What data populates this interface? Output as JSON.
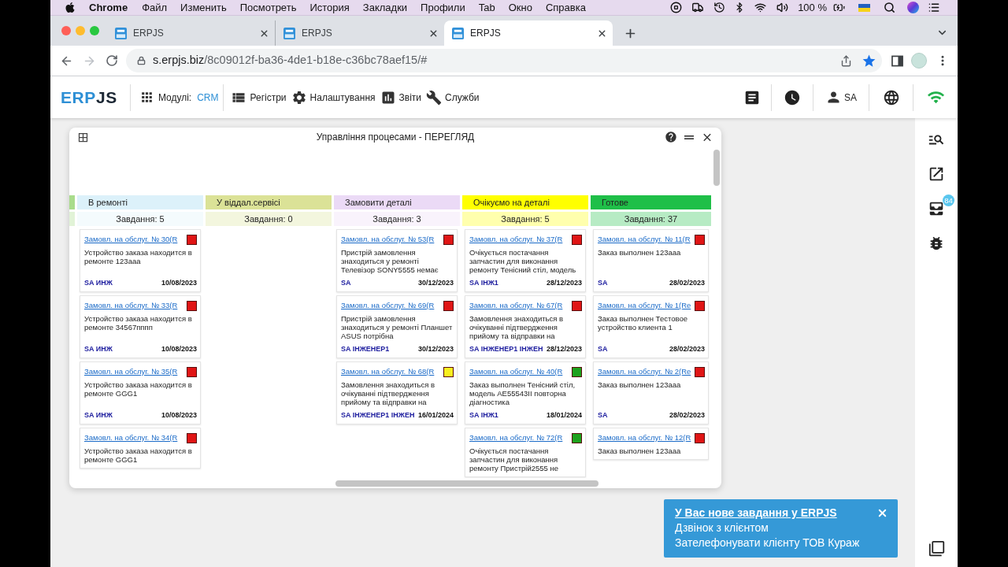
{
  "menubar": {
    "app": "Chrome",
    "menus": [
      "Файл",
      "Изменить",
      "Посмотреть",
      "История",
      "Закладки",
      "Профили",
      "Tab",
      "Окно",
      "Справка"
    ],
    "battery": "100 %"
  },
  "browser": {
    "tabs": [
      {
        "title": "ERPJS",
        "selected": false
      },
      {
        "title": "ERPJS",
        "selected": false
      },
      {
        "title": "ERPJS",
        "selected": true
      }
    ],
    "back_disabled": false,
    "forward_disabled": true,
    "url_host": "s.erpjs.biz",
    "url_path": "/8c09012f-ba36-4de1-b18e-c36bc78aef15/#",
    "bookmarked": true
  },
  "header": {
    "logo": [
      "ERP",
      "JS"
    ],
    "modules_label": "Модулі:",
    "module": "CRM",
    "nav": [
      "Регістри",
      "Налаштування",
      "Звіти",
      "Служби"
    ],
    "user": "SA"
  },
  "window": {
    "title": "Управління процесами - ПЕРЕГЛЯД",
    "columns": [
      {
        "color": "#a9dc8c"
      },
      {
        "title": "В ремонті",
        "color": "#dcf1fa",
        "count": "Завдання: 5",
        "cards": [
          {
            "title": "Замовл. на обслуг. № 30(R",
            "color": "#e01515",
            "description": "Устройство заказа находится в ремонте 123aaa",
            "assignee": "SA ИНЖ",
            "date": "10/08/2023"
          },
          {
            "title": "Замовл. на обслуг. № 33(R",
            "color": "#e01515",
            "description": "Устройство заказа находится в ремонте 34567пппп",
            "assignee": "SA ИНЖ",
            "date": "10/08/2023"
          },
          {
            "title": "Замовл. на обслуг. № 35(R",
            "color": "#e01515",
            "description": "Устройство заказа находится в ремонте GGG1",
            "assignee": "SA ИНЖ",
            "date": "10/08/2023"
          },
          {
            "title": "Замовл. на обслуг. № 34(R",
            "color": "#e01515",
            "description": "Устройство заказа находится в ремонте GGG1"
          }
        ]
      },
      {
        "title": "У віддал.сервісі",
        "color": "#dbe297",
        "count": "Завдання: 0"
      },
      {
        "title": "Замовити деталі",
        "color": "#ebdaf6",
        "count": "Завдання: 3",
        "cards": [
          {
            "title": "Замовл. на обслуг. № 53(R",
            "color": "#e01515",
            "description": "Пристрій замовлення знаходиться у ремонті Телевізор SONY5555 немає",
            "assignee": "SA",
            "date": "30/12/2023"
          },
          {
            "title": "Замовл. на обслуг. № 69(R",
            "color": "#e01515",
            "description": "Пристрій замовлення знаходиться у ремонті Планшет ASUS потрібна",
            "assignee": "SA ІНЖЕНЕР1",
            "date": "30/12/2023"
          },
          {
            "title": "Замовл. на обслуг. № 68(R",
            "color": "#f7ef1f",
            "description": "Замовлення знаходиться в очікуванні підтвердження прийому та відправки на",
            "assignee": "SA ІНЖЕНЕР1 ІНЖЕН",
            "date": "16/01/2024"
          }
        ]
      },
      {
        "title": "Очікуємо на деталі",
        "color": "#ffff00",
        "count": "Завдання: 5",
        "cards": [
          {
            "title": "Замовл. на обслуг. № 37(R",
            "color": "#e01515",
            "description": "Очікується постачання запчастин для виконання ремонту Тенісний стіл, модель",
            "assignee": "SA ІНЖ1",
            "date": "28/12/2023"
          },
          {
            "title": "Замовл. на обслуг. № 67(R",
            "color": "#e01515",
            "description": "Замовлення знаходиться в очікуванні підтвердження прийому та відправки на",
            "assignee": "SA ІНЖЕНЕР1 ІНЖЕН",
            "date": "28/12/2023"
          },
          {
            "title": "Замовл. на обслуг. № 40(R",
            "color": "#1ea21e",
            "description": "Заказ выполнен Тенісний стіл, модель AE55543II повторна діагностика",
            "assignee": "SA ІНЖ1",
            "date": "18/01/2024"
          },
          {
            "title": "Замовл. на обслуг. № 72(R",
            "color": "#1ea21e",
            "description": "Очікується постачання запчастин для виконання ремонту Пристрій2555 не"
          }
        ]
      },
      {
        "title": "Готове",
        "color": "#1fbf48",
        "count": "Завдання: 37",
        "cards": [
          {
            "title": "Замовл. на обслуг. № 11(R",
            "color": "#e01515",
            "description": "Заказ выполнен 123aaa",
            "assignee": "SA",
            "date": "28/02/2023"
          },
          {
            "title": "Замовл. на обслуг. № 1(Re",
            "color": "#e01515",
            "description": "Заказ выполнен Тестовое устройство клиента 1",
            "assignee": "SA",
            "date": "28/02/2023"
          },
          {
            "title": "Замовл. на обслуг. № 2(Re",
            "color": "#e01515",
            "description": "Заказ выполнен 123aaa",
            "assignee": "SA",
            "date": "28/02/2023"
          },
          {
            "title": "Замовл. на обслуг. № 12(R",
            "color": "#e01515",
            "description": "Заказ выполнен 123aaa"
          }
        ]
      }
    ]
  },
  "sidebar": {
    "inbox_badge": "84"
  },
  "notification": {
    "title": "У Вас нове завдання у ERPJS",
    "lines": [
      "Дзвінок з клієнтом",
      "Зателефонувати клієнту ТОВ Кураж"
    ]
  }
}
